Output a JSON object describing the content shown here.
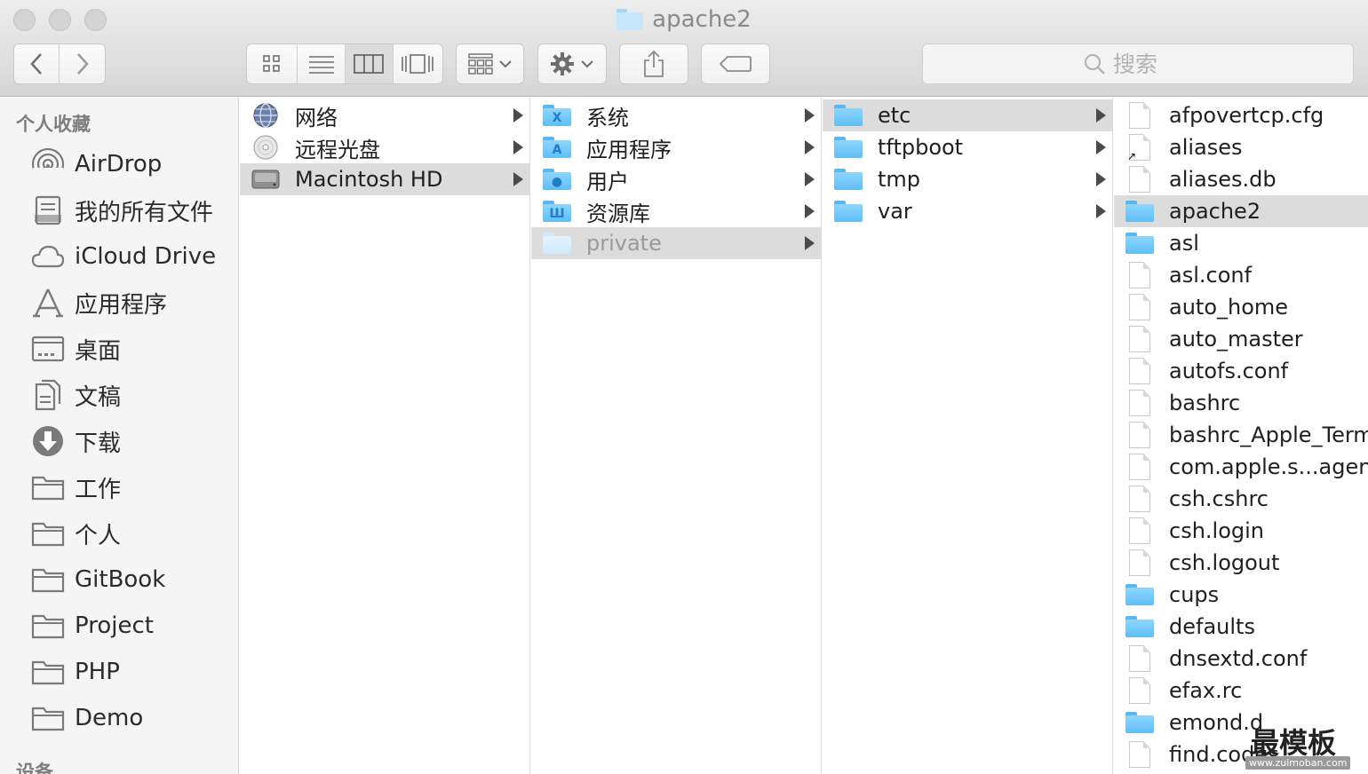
{
  "window": {
    "title": "apache2"
  },
  "toolbar": {
    "search_placeholder": "搜索",
    "view_modes": [
      "icon-view",
      "list-view",
      "column-view",
      "cover-flow-view"
    ],
    "active_view": "column-view"
  },
  "sidebar": {
    "favorites_header": "个人收藏",
    "devices_header": "设备",
    "items": [
      {
        "label": "AirDrop",
        "icon": "airdrop-icon"
      },
      {
        "label": "我的所有文件",
        "icon": "all-files-icon"
      },
      {
        "label": "iCloud Drive",
        "icon": "cloud-icon"
      },
      {
        "label": "应用程序",
        "icon": "applications-icon"
      },
      {
        "label": "桌面",
        "icon": "desktop-icon"
      },
      {
        "label": "文稿",
        "icon": "documents-icon"
      },
      {
        "label": "下载",
        "icon": "download-icon"
      },
      {
        "label": "工作",
        "icon": "folder-icon"
      },
      {
        "label": "个人",
        "icon": "folder-icon"
      },
      {
        "label": "GitBook",
        "icon": "folder-icon"
      },
      {
        "label": "Project",
        "icon": "folder-icon"
      },
      {
        "label": "PHP",
        "icon": "folder-icon"
      },
      {
        "label": "Demo",
        "icon": "folder-icon"
      }
    ]
  },
  "columns": [
    {
      "items": [
        {
          "name": "网络",
          "icon": "network-globe-icon",
          "arrow": true
        },
        {
          "name": "远程光盘",
          "icon": "remote-disc-icon",
          "arrow": true
        },
        {
          "name": "Macintosh HD",
          "icon": "hard-drive-icon",
          "arrow": true,
          "selected": true
        }
      ]
    },
    {
      "items": [
        {
          "name": "系统",
          "icon": "system-folder-icon",
          "arrow": true
        },
        {
          "name": "应用程序",
          "icon": "applications-folder-icon",
          "arrow": true
        },
        {
          "name": "用户",
          "icon": "users-folder-icon",
          "arrow": true
        },
        {
          "name": "资源库",
          "icon": "library-folder-icon",
          "arrow": true
        },
        {
          "name": "private",
          "icon": "folder-icon",
          "arrow": true,
          "selected": true,
          "dimmed": true
        }
      ]
    },
    {
      "items": [
        {
          "name": "etc",
          "icon": "folder-icon",
          "arrow": true,
          "selected": true
        },
        {
          "name": "tftpboot",
          "icon": "folder-icon",
          "arrow": true
        },
        {
          "name": "tmp",
          "icon": "folder-icon",
          "arrow": true
        },
        {
          "name": "var",
          "icon": "folder-icon",
          "arrow": true
        }
      ]
    },
    {
      "items": [
        {
          "name": "afpovertcp.cfg",
          "icon": "document-icon"
        },
        {
          "name": "aliases",
          "icon": "alias-document-icon"
        },
        {
          "name": "aliases.db",
          "icon": "document-icon"
        },
        {
          "name": "apache2",
          "icon": "folder-icon",
          "selected": true
        },
        {
          "name": "asl",
          "icon": "folder-icon"
        },
        {
          "name": "asl.conf",
          "icon": "document-icon"
        },
        {
          "name": "auto_home",
          "icon": "document-icon"
        },
        {
          "name": "auto_master",
          "icon": "document-icon"
        },
        {
          "name": "autofs.conf",
          "icon": "document-icon"
        },
        {
          "name": "bashrc",
          "icon": "document-icon"
        },
        {
          "name": "bashrc_Apple_Termi",
          "icon": "document-icon"
        },
        {
          "name": "com.apple.s...agent.",
          "icon": "document-icon"
        },
        {
          "name": "csh.cshrc",
          "icon": "document-icon"
        },
        {
          "name": "csh.login",
          "icon": "document-icon"
        },
        {
          "name": "csh.logout",
          "icon": "document-icon"
        },
        {
          "name": "cups",
          "icon": "folder-icon"
        },
        {
          "name": "defaults",
          "icon": "folder-icon"
        },
        {
          "name": "dnsextd.conf",
          "icon": "document-icon"
        },
        {
          "name": "efax.rc",
          "icon": "document-icon"
        },
        {
          "name": "emond.d",
          "icon": "folder-icon"
        },
        {
          "name": "find.codes",
          "icon": "document-icon"
        }
      ]
    }
  ],
  "watermark": {
    "text": "最模板",
    "url": "www.zuimoban.com"
  }
}
